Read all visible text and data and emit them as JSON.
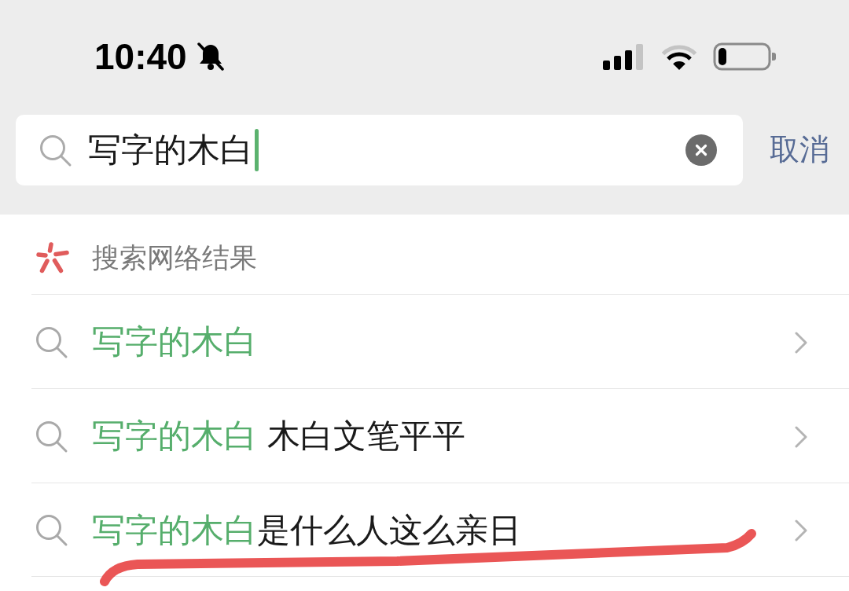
{
  "status_bar": {
    "time": "10:40",
    "silent": true
  },
  "search": {
    "value": "写字的木白",
    "focused": true,
    "cancel": "取消"
  },
  "section": {
    "title": "搜索网络结果"
  },
  "suggestions": [
    {
      "match": "写字的木白",
      "underlined": false
    },
    {
      "match": "写字的木白",
      "rest": " 木白文笔平平",
      "underlined": false
    },
    {
      "match": "写字的木白",
      "rest": "是什么人这么亲日",
      "underlined": true
    }
  ]
}
